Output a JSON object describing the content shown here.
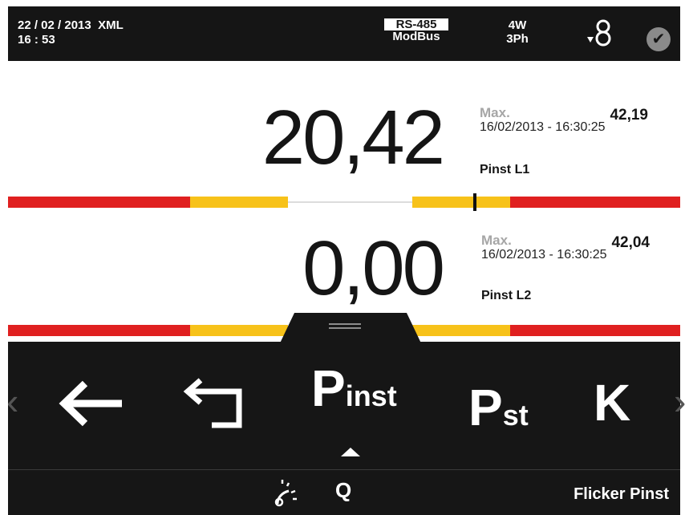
{
  "status_bar": {
    "date": "22 / 02 / 2013",
    "format": "XML",
    "time": "16 : 53",
    "comm_protocol": "RS-485",
    "comm_mode": "ModBus",
    "wiring_line1": "4W",
    "wiring_line2": "3Ph",
    "check_glyph": "✔"
  },
  "readings": [
    {
      "value": "20,42",
      "max_label": "Max.",
      "max_value": "42,19",
      "max_datetime": "16/02/2013 - 16:30:25",
      "parameter": "Pinst L1",
      "marker_level": 0.695
    },
    {
      "value": "0,00",
      "max_label": "Max.",
      "max_value": "42,04",
      "max_datetime": "16/02/2013 - 16:30:25",
      "parameter": "Pinst L2"
    }
  ],
  "menu": {
    "prev_glyph": "‹",
    "next_glyph": "›",
    "pinst_main": "P",
    "pinst_sub": "inst",
    "pst_main": "P",
    "pst_sub": "st",
    "k_label": "K",
    "quality_label": "Q",
    "screen_title": "Flicker Pinst"
  },
  "icons": {
    "back": "back-arrow-icon",
    "return": "return-arrow-icon",
    "sensor": "current-sensor-icon",
    "status": "check-icon",
    "quality": "power-quality-icon"
  },
  "colors": {
    "alarm": "#e02020",
    "warning": "#f7c21a",
    "background_dark": "#151515"
  }
}
